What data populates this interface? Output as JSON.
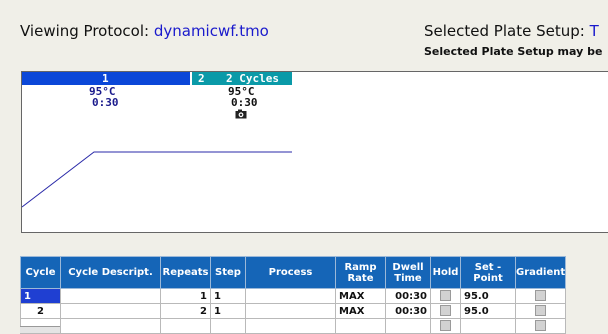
{
  "header": {
    "viewing_label": "Viewing Protocol:",
    "protocol_name": "dynamicwf.tmo",
    "selected_label": "Selected Plate Setup:",
    "selected_value": "T",
    "selected_note": "Selected Plate Setup may be"
  },
  "graph": {
    "segments": [
      {
        "number": "1",
        "temperature": "95°C",
        "time": "0:30"
      },
      {
        "index": "2",
        "cycles_label": "2 Cycles",
        "temperature": "95°C",
        "time": "0:30",
        "icon": "camera-icon"
      }
    ],
    "line_color": "#2a2aa8"
  },
  "table": {
    "columns": [
      "Cycle",
      "Cycle Descript.",
      "Repeats",
      "Step",
      "Process",
      "Ramp Rate",
      "Dwell Time",
      "Hold",
      "Set - Point",
      "Gradient"
    ],
    "rows": [
      {
        "cycle": "1",
        "description": "",
        "repeats": "1",
        "step": "1",
        "process": "",
        "ramp": "MAX",
        "dwell": "00:30",
        "hold": false,
        "setpoint": "95.0",
        "gradient": false
      },
      {
        "cycle": "2",
        "description": "",
        "repeats": "2",
        "step": "1",
        "process": "",
        "ramp": "MAX",
        "dwell": "00:30",
        "hold": false,
        "setpoint": "95.0",
        "gradient": false
      },
      {
        "cycle": "",
        "description": "",
        "repeats": "",
        "step": "",
        "process": "",
        "ramp": "",
        "dwell": "",
        "hold": false,
        "setpoint": "",
        "gradient": false
      }
    ],
    "header_color": "#1565b7",
    "selected_color": "#1f3fd2"
  }
}
